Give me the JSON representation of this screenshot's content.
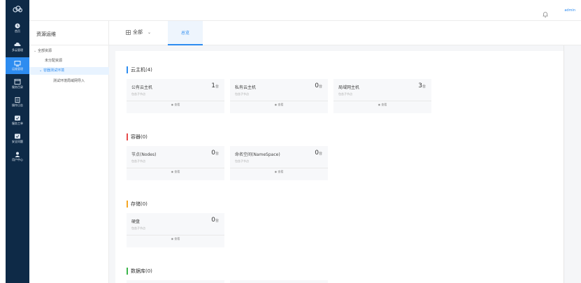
{
  "colors": {
    "rail_bg": "#0e2a47",
    "accent": "#2d8cf0",
    "section_compute": "#2d8cf0",
    "section_container": "#e64a4a",
    "section_storage": "#f5a623",
    "section_database": "#3bb54a"
  },
  "rail": {
    "logo_icon": "cloud-logo-icon",
    "items": [
      {
        "label": "首页",
        "icon": "home-icon"
      },
      {
        "label": "多云管理",
        "icon": "cloud-icon"
      },
      {
        "label": "运维管理",
        "icon": "monitor-icon"
      },
      {
        "label": "服务目录",
        "icon": "window-icon"
      },
      {
        "label": "操作日志",
        "icon": "list-icon"
      },
      {
        "label": "服务工单",
        "icon": "ticket-icon"
      },
      {
        "label": "安全问题",
        "icon": "shield-icon"
      },
      {
        "label": "用户中心",
        "icon": "user-icon"
      }
    ]
  },
  "header": {
    "user": "admin"
  },
  "tree": {
    "title": "资源运维",
    "nodes": [
      {
        "label": "全部资源",
        "caret": "⌄"
      },
      {
        "label": "未分配资源",
        "caret": ""
      },
      {
        "label": "容器测试环境",
        "caret": "⌄"
      },
      {
        "label": "测试环境局域网导入",
        "caret": ""
      }
    ]
  },
  "tabs": {
    "select_label": "全部",
    "active_tab": "总览"
  },
  "sections": [
    {
      "title": "云主机(4)",
      "cards": [
        {
          "name": "公有云主机",
          "count": "1",
          "unit": "台",
          "sub": "包含子节点",
          "view": "查看"
        },
        {
          "name": "私有云主机",
          "count": "0",
          "unit": "台",
          "sub": "包含子节点",
          "view": "查看"
        },
        {
          "name": "局域网主机",
          "count": "3",
          "unit": "台",
          "sub": "包含子节点",
          "view": "查看"
        }
      ]
    },
    {
      "title": "容器(0)",
      "cards": [
        {
          "name": "节点(Nodes)",
          "count": "0",
          "unit": "台",
          "sub": "包含子节点",
          "view": "查看"
        },
        {
          "name": "命名空间(NameSpace)",
          "count": "0",
          "unit": "台",
          "sub": "包含子节点",
          "view": "查看"
        }
      ]
    },
    {
      "title": "存储(0)",
      "cards": [
        {
          "name": "硬盘",
          "count": "0",
          "unit": "台",
          "sub": "包含子节点",
          "view": "查看"
        }
      ]
    },
    {
      "title": "数据库(0)",
      "cards": []
    }
  ]
}
